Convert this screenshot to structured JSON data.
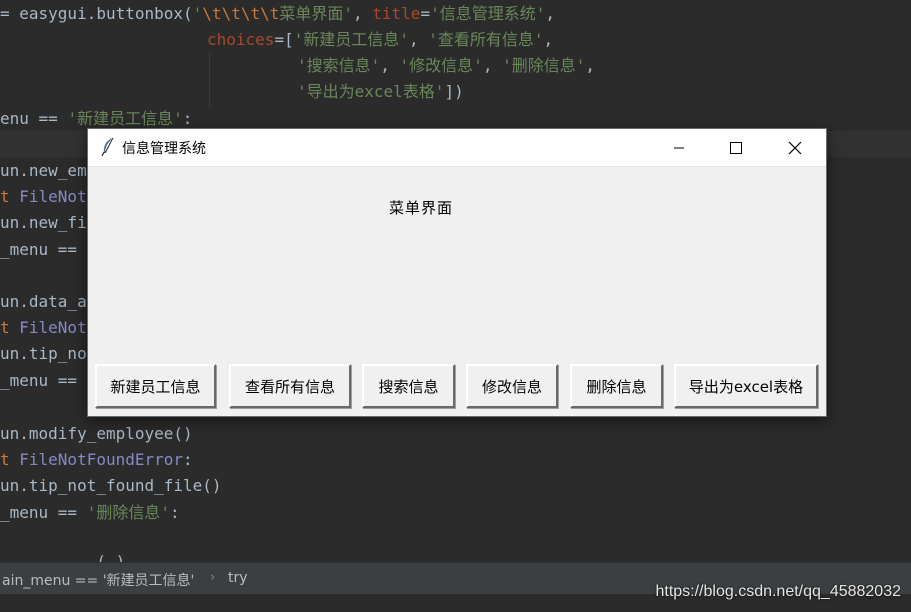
{
  "code": {
    "line1": {
      "pre": "= easygui.buttonbox(",
      "str1": "'",
      "esc": "\\t\\t\\t\\t",
      "str2": "菜单界面'",
      "mid": ", ",
      "kwarg": "title",
      "eq": "=",
      "str3": "'信息管理系统'",
      "tail": ","
    },
    "line2": {
      "kwarg": "choices",
      "eq": "=[",
      "str": "'新建员工信息'",
      "sep": ", ",
      "str2": "'查看所有信息'",
      "tail": ","
    },
    "line3": {
      "str": "'搜索信息'",
      "sep1": ", ",
      "str2": "'修改信息'",
      "sep2": ", ",
      "str3": "'删除信息'",
      "tail": ","
    },
    "line4": {
      "str": "'导出为excel表格'",
      "tail": "])"
    },
    "line5": {
      "pre": "enu == ",
      "str": "'新建员工信息'",
      "tail": ":"
    },
    "line7": "un.new_em",
    "line8": {
      "kw": "t ",
      "cls": "FileNot"
    },
    "line9": "un.new_fi",
    "line10": "_menu ==",
    "line12": "un.data_a",
    "line13": {
      "kw": "t ",
      "cls": "FileNot"
    },
    "line14": "un.tip_no",
    "line15": "_menu ==",
    "line17": "un.modify_employee()",
    "line18": {
      "kw": "t ",
      "cls": "FileNotFoundError",
      "tail": ":"
    },
    "line19": "un.tip_not_found_file()",
    "line20": {
      "pre": "_menu == ",
      "str": "'删除信息'",
      "tail": ":"
    },
    "line22": "          ( )"
  },
  "statusbar": {
    "crumb1": "ain_menu == '新建员工信息'",
    "crumb_sep": "›",
    "crumb2": "try"
  },
  "watermark": "https://blog.csdn.net/qq_45882032",
  "dialog": {
    "title": "信息管理系统",
    "message": "菜单界面",
    "buttons": [
      "新建员工信息",
      "查看所有信息",
      "搜索信息",
      "修改信息",
      "删除信息",
      "导出为excel表格"
    ],
    "icons": {
      "app": "feather-icon",
      "minimize": "minimize-icon",
      "maximize": "maximize-icon",
      "close": "close-icon"
    }
  }
}
